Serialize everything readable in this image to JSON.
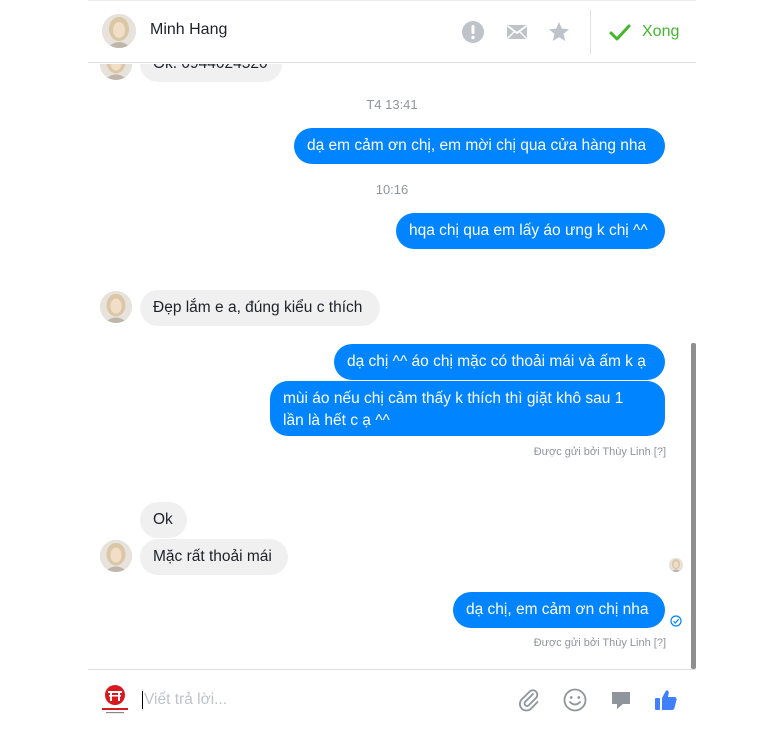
{
  "header": {
    "contact_name": "Minh Hang",
    "done_label": "Xong",
    "icons": [
      "alert-icon",
      "envelope-icon",
      "star-icon",
      "checkmark-icon"
    ]
  },
  "thread": {
    "clipped_top_message": "Ok. 0944024520",
    "messages": [
      {
        "type": "timestamp",
        "text": "T4 13:41"
      },
      {
        "type": "outgoing",
        "text": "dạ em cảm ơn chị, em mời chị qua cửa hàng nha"
      },
      {
        "type": "timestamp",
        "text": "10:16"
      },
      {
        "type": "outgoing",
        "text": "hqa chị qua em lấy áo ưng k chị ^^"
      },
      {
        "type": "incoming",
        "text": "Đẹp lắm e a, đúng kiểu c thích"
      },
      {
        "type": "outgoing",
        "text": "dạ chị ^^ áo chị mặc có thoải mái và ấm k ạ"
      },
      {
        "type": "outgoing",
        "lines": [
          "mùi áo nếu chị cảm thấy k thích thì giặt khô sau 1",
          "lần là hết c ạ ^^"
        ]
      },
      {
        "type": "sent_by",
        "text": "Được gửi bởi Thùy Linh",
        "help": "[?]"
      },
      {
        "type": "incoming",
        "text": "Ok"
      },
      {
        "type": "incoming",
        "text": "Mặc rất thoải mái"
      },
      {
        "type": "outgoing",
        "text": "dạ chị, em cảm ơn chị nha"
      },
      {
        "type": "sent_by",
        "text": "Được gửi bởi Thùy Linh",
        "help": "[?]"
      }
    ]
  },
  "composer": {
    "placeholder": "Viết trả lời...",
    "value": "",
    "icons": [
      "attachment-icon",
      "emoji-icon",
      "sticker-icon",
      "like-icon"
    ]
  },
  "colors": {
    "outgoing_bubble": "#0084ff",
    "incoming_bubble": "#f1f0f0",
    "done_green": "#42b72a",
    "like_blue": "#4080ff",
    "header_icon_gray": "#bec3c9"
  }
}
